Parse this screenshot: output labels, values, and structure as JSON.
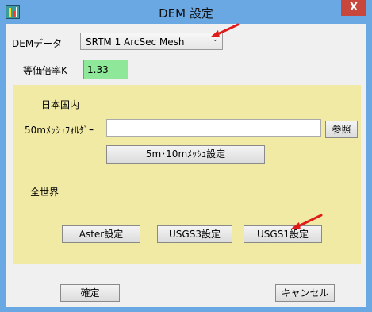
{
  "window": {
    "title": "DEM  設定",
    "close_glyph": "X"
  },
  "dem": {
    "label": "DEMデータ",
    "selected": "SRTM 1 ArcSec Mesh"
  },
  "k": {
    "label": "等価倍率K",
    "value": "1.33"
  },
  "japan": {
    "heading": "日本国内",
    "folder_label": "50mﾒｯｼｭﾌｫﾙﾀﾞｰ",
    "folder_value": "",
    "browse_label": "参照",
    "mesh_settings_label": "5m･10mﾒｯｼｭ設定"
  },
  "world": {
    "heading": "全世界",
    "aster_label": "Aster設定",
    "usgs3_label": "USGS3設定",
    "usgs1_label": "USGS1設定"
  },
  "footer": {
    "ok_label": "確定",
    "cancel_label": "キャンセル"
  },
  "colors": {
    "title_bar": "#6aa8e4",
    "panel": "#f1eaa4",
    "k_field": "#8fe89a",
    "annotation_arrow": "#e01b1b"
  }
}
